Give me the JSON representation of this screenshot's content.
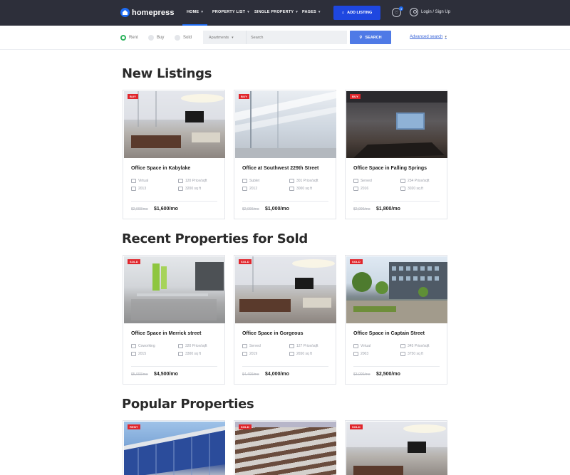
{
  "nav": {
    "logo": "homepress",
    "menu": [
      {
        "label": "HOME"
      },
      {
        "label": "PROPERTY LIST"
      },
      {
        "label": "SINGLE PROPERTY"
      },
      {
        "label": "PAGES"
      }
    ],
    "add_listing": "ADD LISTING",
    "favorites_count": "3",
    "login": "Login / Sign Up"
  },
  "search": {
    "options": [
      "Rent",
      "Buy",
      "Sold"
    ],
    "type_select": "Apartments",
    "placeholder": "Search",
    "button": "SEARCH",
    "advanced": "Advanced search"
  },
  "sections": [
    {
      "title": "New Listings",
      "cards": [
        {
          "badge": "BUY",
          "title": "Office Space in Kabylake",
          "m1": "Virtual",
          "m2": "120 Price/sqft",
          "m3": "2013",
          "m4": "3200 sq ft",
          "old": "$2,000/mo",
          "price": "$1,600/mo"
        },
        {
          "badge": "BUY",
          "title": "Office at Southwest 229th Street",
          "m1": "Sublet",
          "m2": "301 Price/sqft",
          "m3": "2012",
          "m4": "3000 sq ft",
          "old": "$2,000/mo",
          "price": "$1,000/mo"
        },
        {
          "badge": "BUY",
          "title": "Office Space in Falling Springs",
          "m1": "Served",
          "m2": "234 Price/sqft",
          "m3": "2016",
          "m4": "3020 sq ft",
          "old": "$2,000/mo",
          "price": "$1,800/mo"
        }
      ]
    },
    {
      "title": "Recent Properties for Sold",
      "cards": [
        {
          "badge": "SOLD",
          "title": "Office Space in Merrick street",
          "m1": "Coworking",
          "m2": "320 Price/sqft",
          "m3": "2015",
          "m4": "3300 sq ft",
          "old": "$5,000/mo",
          "price": "$4,500/mo"
        },
        {
          "badge": "SOLD",
          "title": "Office Space in Gorgeous",
          "m1": "Served",
          "m2": "127 Price/sqft",
          "m3": "2019",
          "m4": "2650 sq ft",
          "old": "$4,400/mo",
          "price": "$4,000/mo"
        },
        {
          "badge": "SOLD",
          "title": "Office Space in Captain Street",
          "m1": "Virtual",
          "m2": "345 Price/sqft",
          "m3": "2003",
          "m4": "3750 sq ft",
          "old": "$3,000/mo",
          "price": "$2,500/mo"
        }
      ]
    },
    {
      "title": "Popular Properties",
      "cards": [
        {
          "badge": "RENT"
        },
        {
          "badge": "SOLD"
        },
        {
          "badge": "SOLD"
        }
      ]
    }
  ]
}
